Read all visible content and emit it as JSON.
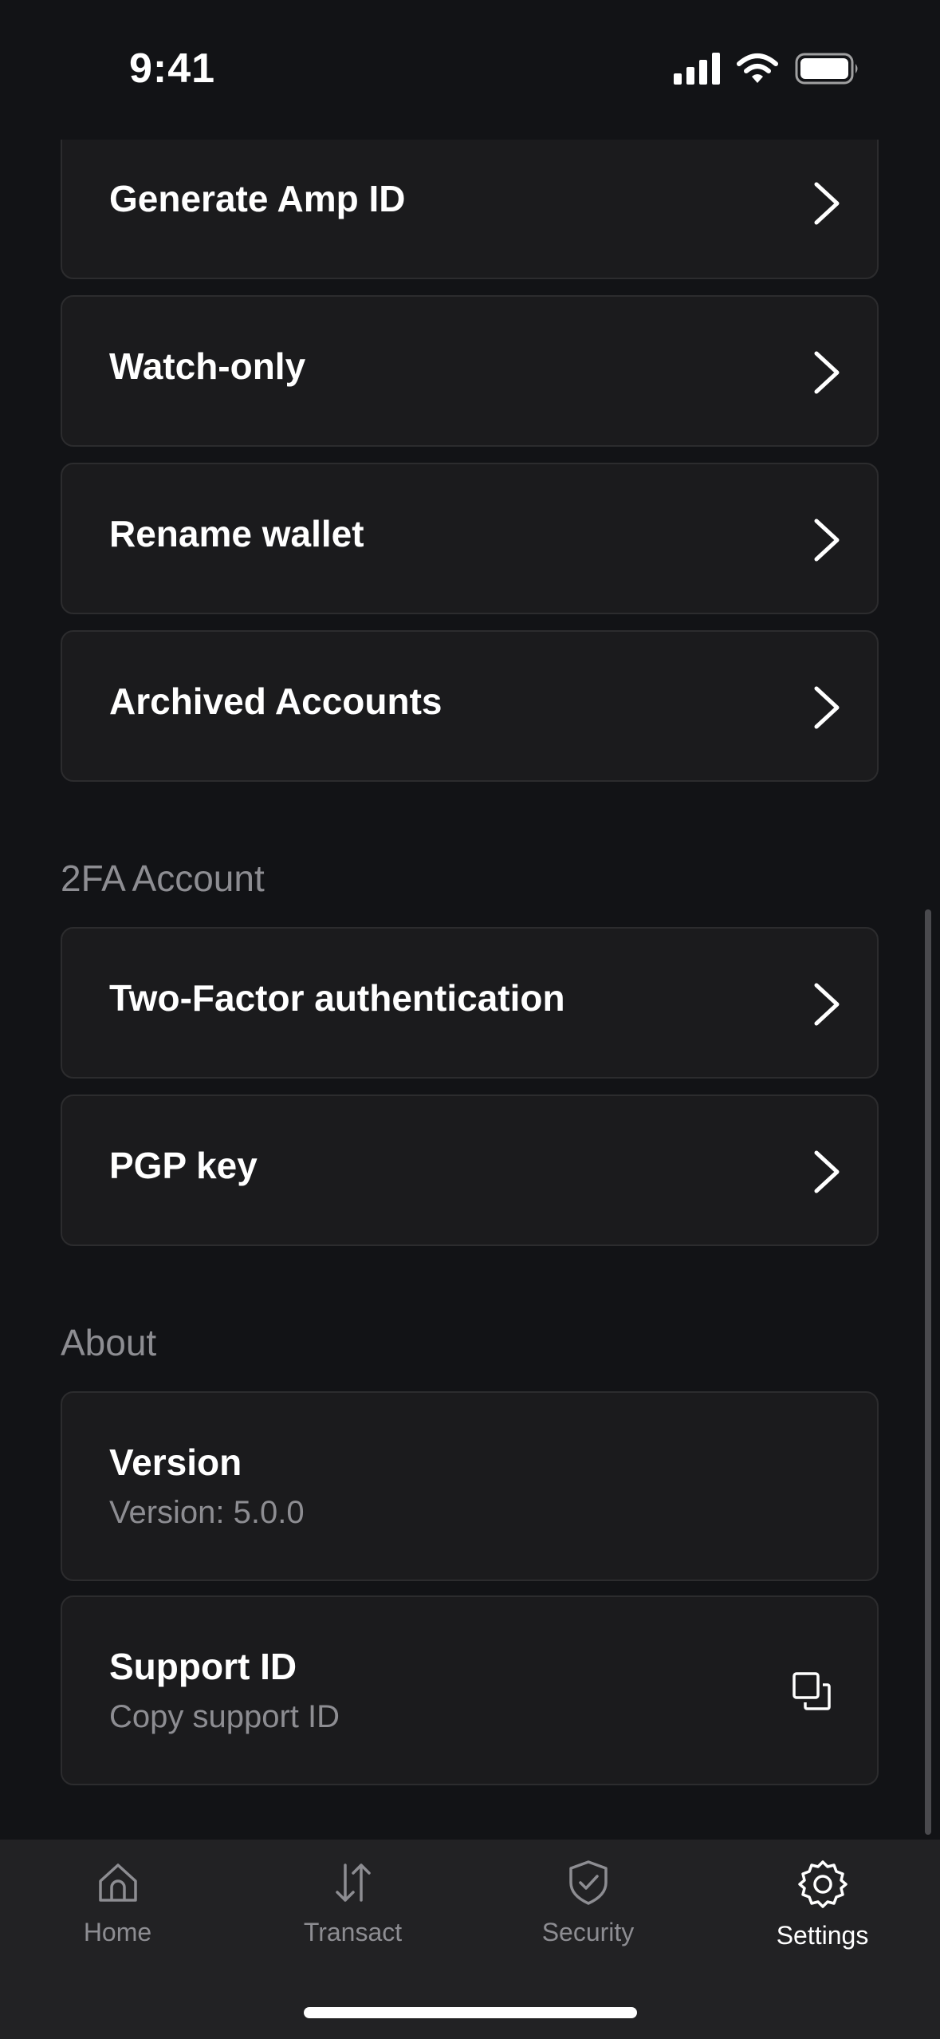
{
  "status_bar": {
    "time": "9:41",
    "icons": [
      "signal-icon",
      "wifi-icon",
      "battery-icon"
    ]
  },
  "wallet_items": [
    {
      "label": "Generate Amp ID"
    },
    {
      "label": "Watch-only"
    },
    {
      "label": "Rename wallet"
    },
    {
      "label": "Archived Accounts"
    }
  ],
  "twofa_section": {
    "title": "2FA Account",
    "items": [
      {
        "label": "Two-Factor authentication"
      },
      {
        "label": "PGP key"
      }
    ]
  },
  "about_section": {
    "title": "About",
    "version": {
      "title": "Version",
      "subtitle": "Version: 5.0.0"
    },
    "support": {
      "title": "Support ID",
      "subtitle": "Copy support ID",
      "icon": "copy-icon"
    }
  },
  "tab_bar": {
    "tabs": [
      {
        "label": "Home",
        "icon": "home-icon"
      },
      {
        "label": "Transact",
        "icon": "arrows-up-down-icon"
      },
      {
        "label": "Security",
        "icon": "shield-check-icon"
      },
      {
        "label": "Settings",
        "icon": "gear-icon"
      }
    ],
    "active": "Settings"
  },
  "colors": {
    "background": "#121316",
    "card": "#1b1b1d",
    "card_border": "#2c2c2e",
    "muted_text": "#8d8d92",
    "tab_bar": "#222224"
  }
}
